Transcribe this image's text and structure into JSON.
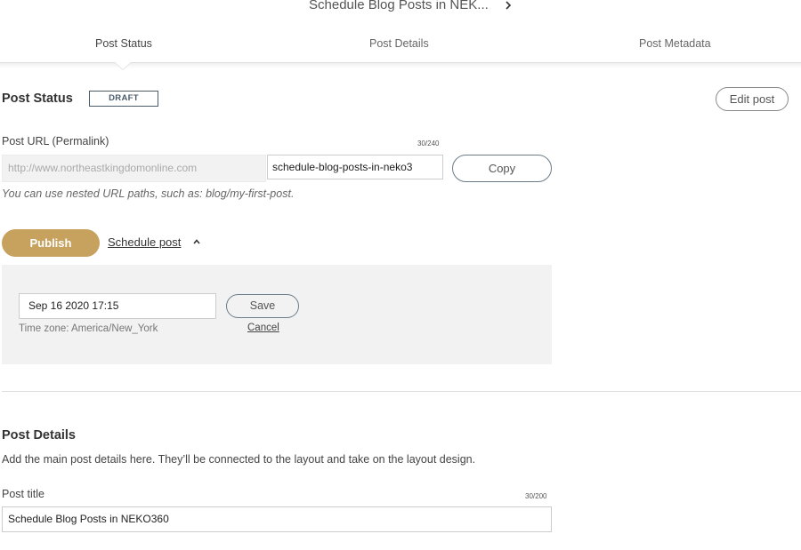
{
  "header": {
    "title": "Schedule Blog Posts in NEK...",
    "chevron_icon": "chevron-right-icon"
  },
  "tabs": [
    {
      "label": "Post Status",
      "active": true
    },
    {
      "label": "Post Details",
      "active": false
    },
    {
      "label": "Post Metadata",
      "active": false
    }
  ],
  "post_status": {
    "title": "Post Status",
    "badge": "DRAFT",
    "edit_button": "Edit post",
    "url": {
      "label": "Post URL (Permalink)",
      "counter": "30/240",
      "base": "http://www.northeastkingdomonline.com",
      "slug": "schedule-blog-posts-in-neko3",
      "copy_button": "Copy",
      "hint": "You can use nested URL paths, such as: blog/my-first-post."
    },
    "publish_button": "Publish",
    "schedule_link": "Schedule post",
    "schedule_toggle_icon": "chevron-up-icon",
    "schedule": {
      "datetime": "Sep 16 2020 17:15",
      "save_button": "Save",
      "timezone": "Time zone: America/New_York",
      "cancel_link": "Cancel"
    }
  },
  "post_details": {
    "title": "Post Details",
    "description": "Add the main post details here. They’ll be connected to the layout and take on the layout design.",
    "post_title": {
      "label": "Post title",
      "counter": "30/200",
      "value": "Schedule Blog Posts in NEKO360"
    }
  },
  "colors": {
    "publish": "#c7a15e",
    "panel": "#f2f2f2",
    "badge_border": "#4a5c6a"
  }
}
